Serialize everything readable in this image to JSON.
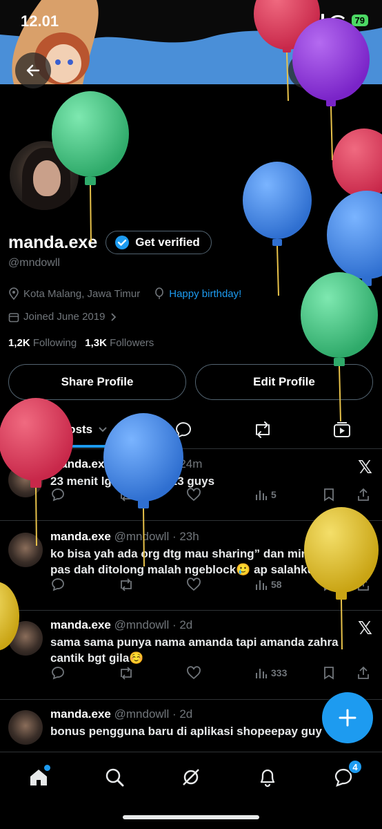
{
  "status_bar": {
    "time": "12.01",
    "battery": "79"
  },
  "profile": {
    "display_name": "manda.exe",
    "get_verified_label": "Get verified",
    "handle": "@mndowll",
    "location": "Kota Malang, Jawa Timur",
    "birthday_text": "Happy birthday!",
    "joined": "Joined June 2019",
    "following_count": "1,2K",
    "following_label": "Following",
    "followers_count": "1,3K",
    "followers_label": "Followers",
    "share_button": "Share Profile",
    "edit_button": "Edit Profile"
  },
  "tabs": {
    "posts_label": "Posts"
  },
  "posts": [
    {
      "name": "manda.exe",
      "meta": "@mndowll · 24m",
      "text": "23 menit lg aku umur 23 guys",
      "views": "5"
    },
    {
      "name": "manda.exe",
      "meta": "@mndowll · 23h",
      "text": "ko bisa yah ada org dtg mau sharing” dan minta tolong tp pas dah ditolong malah ngeblock🥲 ap salahku jiers",
      "views": "58"
    },
    {
      "name": "manda.exe",
      "meta": "@mndowll · 2d",
      "text": "sama sama punya nama amanda tapi amanda zahra cantik bgt gila☺️",
      "views": "333"
    },
    {
      "name": "manda.exe",
      "meta": "@mndowll · 2d",
      "text": "bonus pengguna baru di aplikasi shopeepay guy"
    }
  ],
  "bottom_nav": {
    "messages_badge": "4"
  },
  "icons": [
    "back-arrow-icon",
    "grok-icon",
    "search-icon",
    "verified-badge-icon",
    "location-pin-icon",
    "balloon-icon",
    "calendar-icon",
    "chevron-right-icon",
    "posts-tab-icon",
    "chevron-down-icon",
    "replies-icon",
    "reposts-icon",
    "media-icon",
    "x-logo-icon",
    "reply-icon",
    "repost-icon",
    "like-icon",
    "views-icon",
    "bookmark-icon",
    "share-icon",
    "plus-icon",
    "home-icon",
    "explore-icon",
    "grok-nav-icon",
    "notifications-icon",
    "messages-icon"
  ],
  "colors": {
    "accent": "#1d9bf0",
    "background": "#000000",
    "muted": "#71767b",
    "banner": "#4a8fd8"
  }
}
